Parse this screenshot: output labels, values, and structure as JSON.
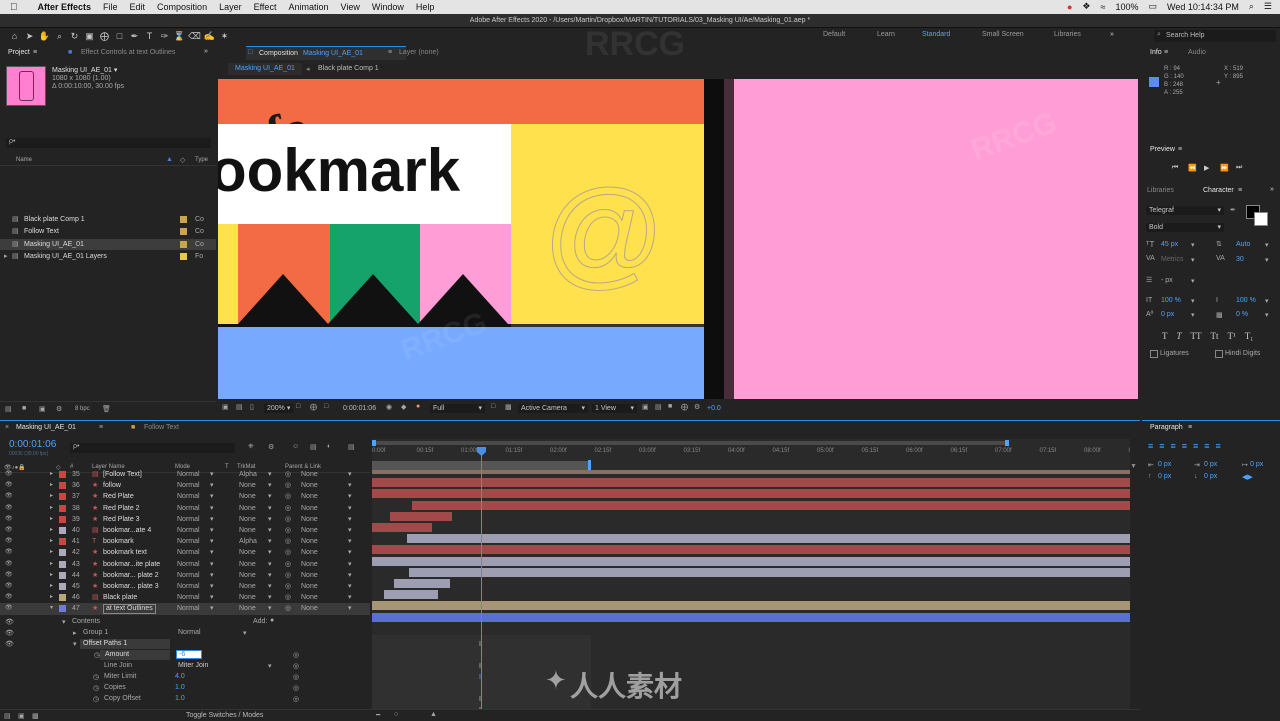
{
  "menubar": {
    "app": "After Effects",
    "items": [
      "File",
      "Edit",
      "Composition",
      "Layer",
      "Effect",
      "Animation",
      "View",
      "Window",
      "Help"
    ],
    "battery": "100%",
    "clock": "Wed 10:14:34 PM"
  },
  "titlebar": {
    "title": "Adobe After Effects 2020 - /Users/Martin/Dropbox/MARTIN/TUTORIALS/03_Masking UI/Ae/Masking_01.aep *"
  },
  "workspaces": [
    "Default",
    "Learn",
    "Standard",
    "Small Screen",
    "Libraries"
  ],
  "search_help": "Search Help",
  "project": {
    "tab": "Project",
    "effect_tab": "Effect Controls at text Outlines",
    "thumb_name": "Masking UI_AE_01 ▾",
    "thumb_dims": "1080 x 1080 (1.00)",
    "thumb_dur": "Δ 0:00:10:00, 30.00 fps",
    "search_placeholder": "ρ•",
    "col_name": "Name",
    "col_type": "Type",
    "items": [
      {
        "name": "Black plate Comp 1",
        "type": "Co",
        "color": "#c9a451"
      },
      {
        "name": "Follow Text",
        "type": "Co",
        "color": "#c9a451"
      },
      {
        "name": "Masking UI_AE_01",
        "type": "Co",
        "color": "#c9a451"
      },
      {
        "name": "Masking UI_AE_01 Layers",
        "type": "Fo",
        "color": "#e8c84a"
      }
    ],
    "bpc": "8 bpc"
  },
  "composition": {
    "tab": "Composition",
    "tab_name": "Masking UI_AE_01",
    "layer_tab": "Layer (none)",
    "sub_tabs": [
      "Masking UI_AE_01",
      "Black plate Comp 1"
    ],
    "canvas": {
      "headline": "ookmark",
      "diag_text": "w.fo",
      "at_symbol": "@"
    },
    "footer": {
      "zoom": "200%",
      "time": "0:00:01:06",
      "quality": "Full",
      "camera": "Active Camera",
      "views": "1 View",
      "exposure": "+0.0"
    }
  },
  "info": {
    "tab": "Info",
    "audio_tab": "Audio",
    "color": "#5c8cf8",
    "values": [
      "R : 94",
      "G : 140",
      "B : 248",
      "A : 255"
    ],
    "x": "X : 519",
    "y": "Y : 895"
  },
  "preview": {
    "tab": "Preview"
  },
  "character": {
    "libraries_tab": "Libraries",
    "tab": "Character",
    "font": "Telegraf",
    "style": "Bold",
    "size": "45 px",
    "leading": "Auto",
    "kerning": "Metrics",
    "tracking": "30",
    "stroke": "- px",
    "vscale": "100 %",
    "hscale": "100 %",
    "baseline": "0 px",
    "tsume": "0 %",
    "ligatures": "Ligatures",
    "hindi": "Hindi Digits"
  },
  "paragraph": {
    "tab": "Paragraph",
    "indent": [
      "0 px",
      "0 px",
      "0 px",
      "0 px",
      "0 px"
    ]
  },
  "timeline": {
    "tab": "Masking UI_AE_01",
    "tab2": "Follow Text",
    "timecode": "0:00:01:06",
    "fps": "00036 (30.00 fps)",
    "search_placeholder": "ρ•",
    "columns": {
      "name": "Layer Name",
      "mode": "Mode",
      "t": "T",
      "trkmat": "TrkMat",
      "parent": "Parent & Link"
    },
    "ruler": [
      "0:00f",
      "00:15f",
      "01:00f",
      "01:15f",
      "02:00f",
      "02:15f",
      "03:00f",
      "03:15f",
      "04:00f",
      "04:15f",
      "05:00f",
      "05:15f",
      "06:00f",
      "06:15f",
      "07:00f",
      "07:15f",
      "08:00f",
      "08"
    ],
    "layers": [
      {
        "num": "35",
        "name": "[Follow Text]",
        "mode": "Normal",
        "trkmat": "Alpha",
        "parent": "None",
        "color": "#c44",
        "icon": "▤"
      },
      {
        "num": "36",
        "name": "follow",
        "mode": "Normal",
        "trkmat": "None",
        "parent": "None",
        "color": "#c44",
        "icon": "★"
      },
      {
        "num": "37",
        "name": "Red Plate",
        "mode": "Normal",
        "trkmat": "None",
        "parent": "None",
        "color": "#c44",
        "icon": "★"
      },
      {
        "num": "38",
        "name": "Red Plate 2",
        "mode": "Normal",
        "trkmat": "None",
        "parent": "None",
        "color": "#c44",
        "icon": "★"
      },
      {
        "num": "39",
        "name": "Red Plate 3",
        "mode": "Normal",
        "trkmat": "None",
        "parent": "None",
        "color": "#c44",
        "icon": "★"
      },
      {
        "num": "40",
        "name": "bookmar...ate 4",
        "mode": "Normal",
        "trkmat": "None",
        "parent": "None",
        "color": "#aab",
        "icon": "▤"
      },
      {
        "num": "41",
        "name": "bookmark",
        "mode": "Normal",
        "trkmat": "Alpha",
        "parent": "None",
        "color": "#c44",
        "icon": "T"
      },
      {
        "num": "42",
        "name": "bookmark text",
        "mode": "Normal",
        "trkmat": "None",
        "parent": "None",
        "color": "#aab",
        "icon": "★"
      },
      {
        "num": "43",
        "name": "bookmar...ite plate",
        "mode": "Normal",
        "trkmat": "None",
        "parent": "None",
        "color": "#aab",
        "icon": "★"
      },
      {
        "num": "44",
        "name": "bookmar... plate 2",
        "mode": "Normal",
        "trkmat": "None",
        "parent": "None",
        "color": "#aab",
        "icon": "★"
      },
      {
        "num": "45",
        "name": "bookmar... plate 3",
        "mode": "Normal",
        "trkmat": "None",
        "parent": "None",
        "color": "#aab",
        "icon": "★"
      },
      {
        "num": "46",
        "name": "Black plate",
        "mode": "Normal",
        "trkmat": "None",
        "parent": "None",
        "color": "#b8a67c",
        "icon": "▤"
      },
      {
        "num": "47",
        "name": "at text Outlines",
        "mode": "Normal",
        "trkmat": "None",
        "parent": "None",
        "color": "#6f7cd8",
        "icon": "★"
      }
    ],
    "contents": {
      "label": "Contents",
      "add": "Add:",
      "group": "Group 1",
      "group_mode": "Normal",
      "offset": "Offset Paths 1",
      "amount_label": "Amount",
      "amount_value": "-6",
      "linejoin_label": "Line Join",
      "linejoin_value": "Miter Join",
      "miter_label": "Miter Limit",
      "miter_value": "4.0",
      "copies_label": "Copies",
      "copies_value": "1.0",
      "copyoffset_label": "Copy Offset",
      "copyoffset_value": "1.0"
    },
    "toggle": "Toggle Switches / Modes"
  },
  "colors": {
    "accent": "#2d8ceb",
    "canvas_orange": "#f36b44",
    "canvas_yellow": "#ffe14e",
    "canvas_pink": "#ff9ed6",
    "canvas_green": "#16a26b",
    "canvas_blue": "#77a9ff",
    "playhead": "#4a90e2"
  },
  "watermarks": [
    "RRCG",
    "人人素材"
  ]
}
